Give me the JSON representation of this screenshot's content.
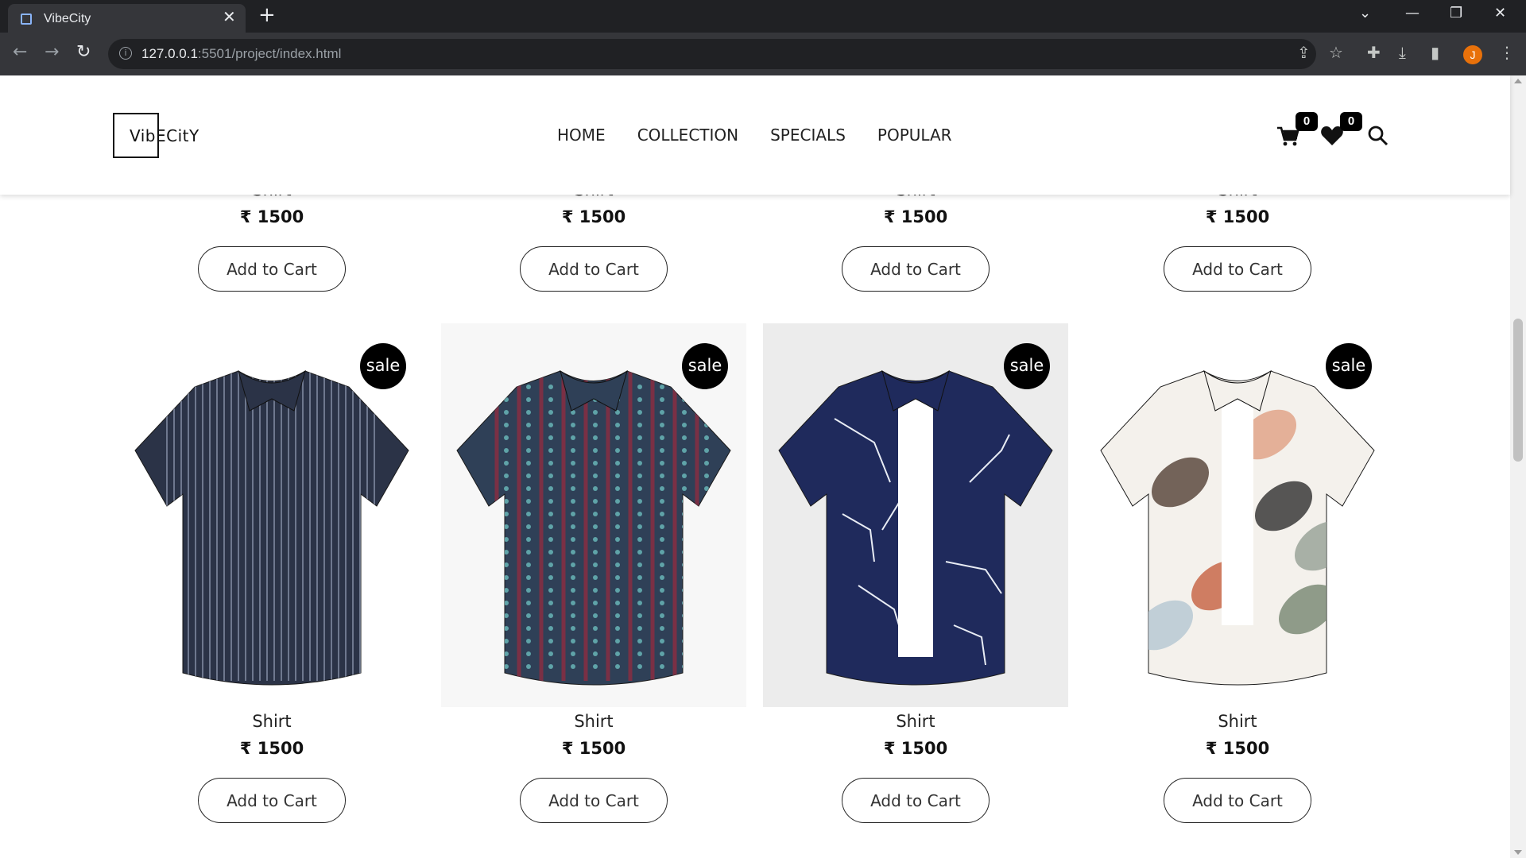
{
  "browser": {
    "tab_title": "VibeCity",
    "url_host": "127.0.0.1",
    "url_rest": ":5501/project/index.html",
    "profile_initial": "J"
  },
  "site": {
    "logo": "VibECitY",
    "nav": [
      "HOME",
      "COLLECTION",
      "SPECIALS",
      "POPULAR"
    ],
    "cart_count": "0",
    "wishlist_count": "0"
  },
  "top_row": [
    {
      "name": "Shirt",
      "price": "₹ 1500",
      "button": "Add to Cart"
    },
    {
      "name": "Shirt",
      "price": "₹ 1500",
      "button": "Add to Cart"
    },
    {
      "name": "Shirt",
      "price": "₹ 1500",
      "button": "Add to Cart"
    },
    {
      "name": "Shirt",
      "price": "₹ 1500",
      "button": "Add to Cart"
    }
  ],
  "products": [
    {
      "name": "Shirt",
      "price": "₹ 1500",
      "button": "Add to Cart",
      "badge": "sale",
      "shirt_color": "#2b3347",
      "pattern": "stripes",
      "bg": "#ffffff"
    },
    {
      "name": "Shirt",
      "price": "₹ 1500",
      "button": "Add to Cart",
      "badge": "sale",
      "shirt_color": "#2f4057",
      "pattern": "ethnic",
      "bg": "#f7f7f7"
    },
    {
      "name": "Shirt",
      "price": "₹ 1500",
      "button": "Add to Cart",
      "badge": "sale",
      "shirt_color": "#1f2a5c",
      "pattern": "abstract",
      "bg": "#ececec"
    },
    {
      "name": "Shirt",
      "price": "₹ 1500",
      "button": "Add to Cart",
      "badge": "sale",
      "shirt_color": "#f4f1ec",
      "pattern": "floral",
      "bg": "#ffffff"
    }
  ]
}
